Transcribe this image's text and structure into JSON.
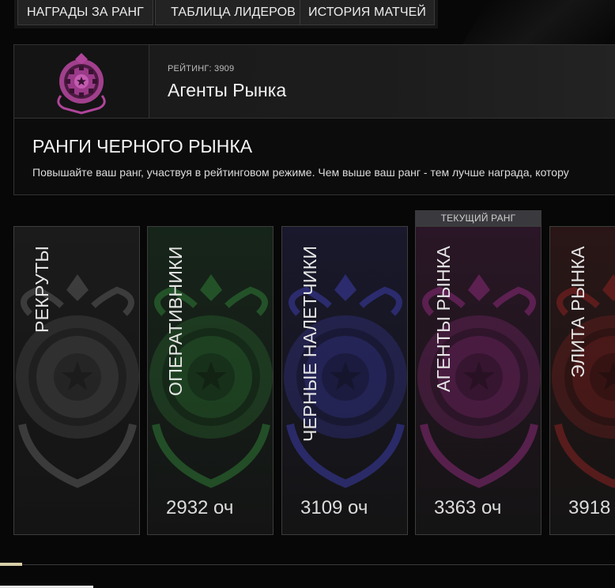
{
  "tabs": [
    {
      "label": "НАГРАДЫ ЗА РАНГ"
    },
    {
      "label": "ТАБЛИЦА ЛИДЕРОВ"
    },
    {
      "label": "ИСТОРИЯ МАТЧЕЙ"
    }
  ],
  "header": {
    "rating": "РЕЙТИНГ: 3909",
    "rank_name": "Агенты Рынка",
    "logo_icon": "black-market-emblem-icon",
    "logo_color": "#b0459a"
  },
  "description": {
    "title": "РАНГИ ЧЕРНОГО РЫНКА",
    "text": "Повышайте ваш ранг, участвуя в рейтинговом режиме. Чем выше ваш ранг - тем лучше награда, котору"
  },
  "current_rank_tag": "ТЕКУЩИЙ РАНГ",
  "ranks": [
    {
      "name": "РЕКРУТЫ",
      "points": "",
      "color": "#5a5a5a",
      "bg": "#1b1b1b"
    },
    {
      "name": "ОПЕРАТИВНИКИ",
      "points": "2932 оч",
      "color": "#2f7a35",
      "bg": "#16251a"
    },
    {
      "name": "ЧЕРНЫЕ НАЛЕТЧИКИ",
      "points": "3109 оч",
      "color": "#3c3ca8",
      "bg": "#19182c"
    },
    {
      "name": "АГЕНТЫ РЫНКА",
      "points": "3363 оч",
      "color": "#8a2a78",
      "bg": "#2a1626"
    },
    {
      "name": "ЭЛИТА РЫНКА",
      "points": "3918",
      "color": "#8a2222",
      "bg": "#2a1616"
    }
  ]
}
